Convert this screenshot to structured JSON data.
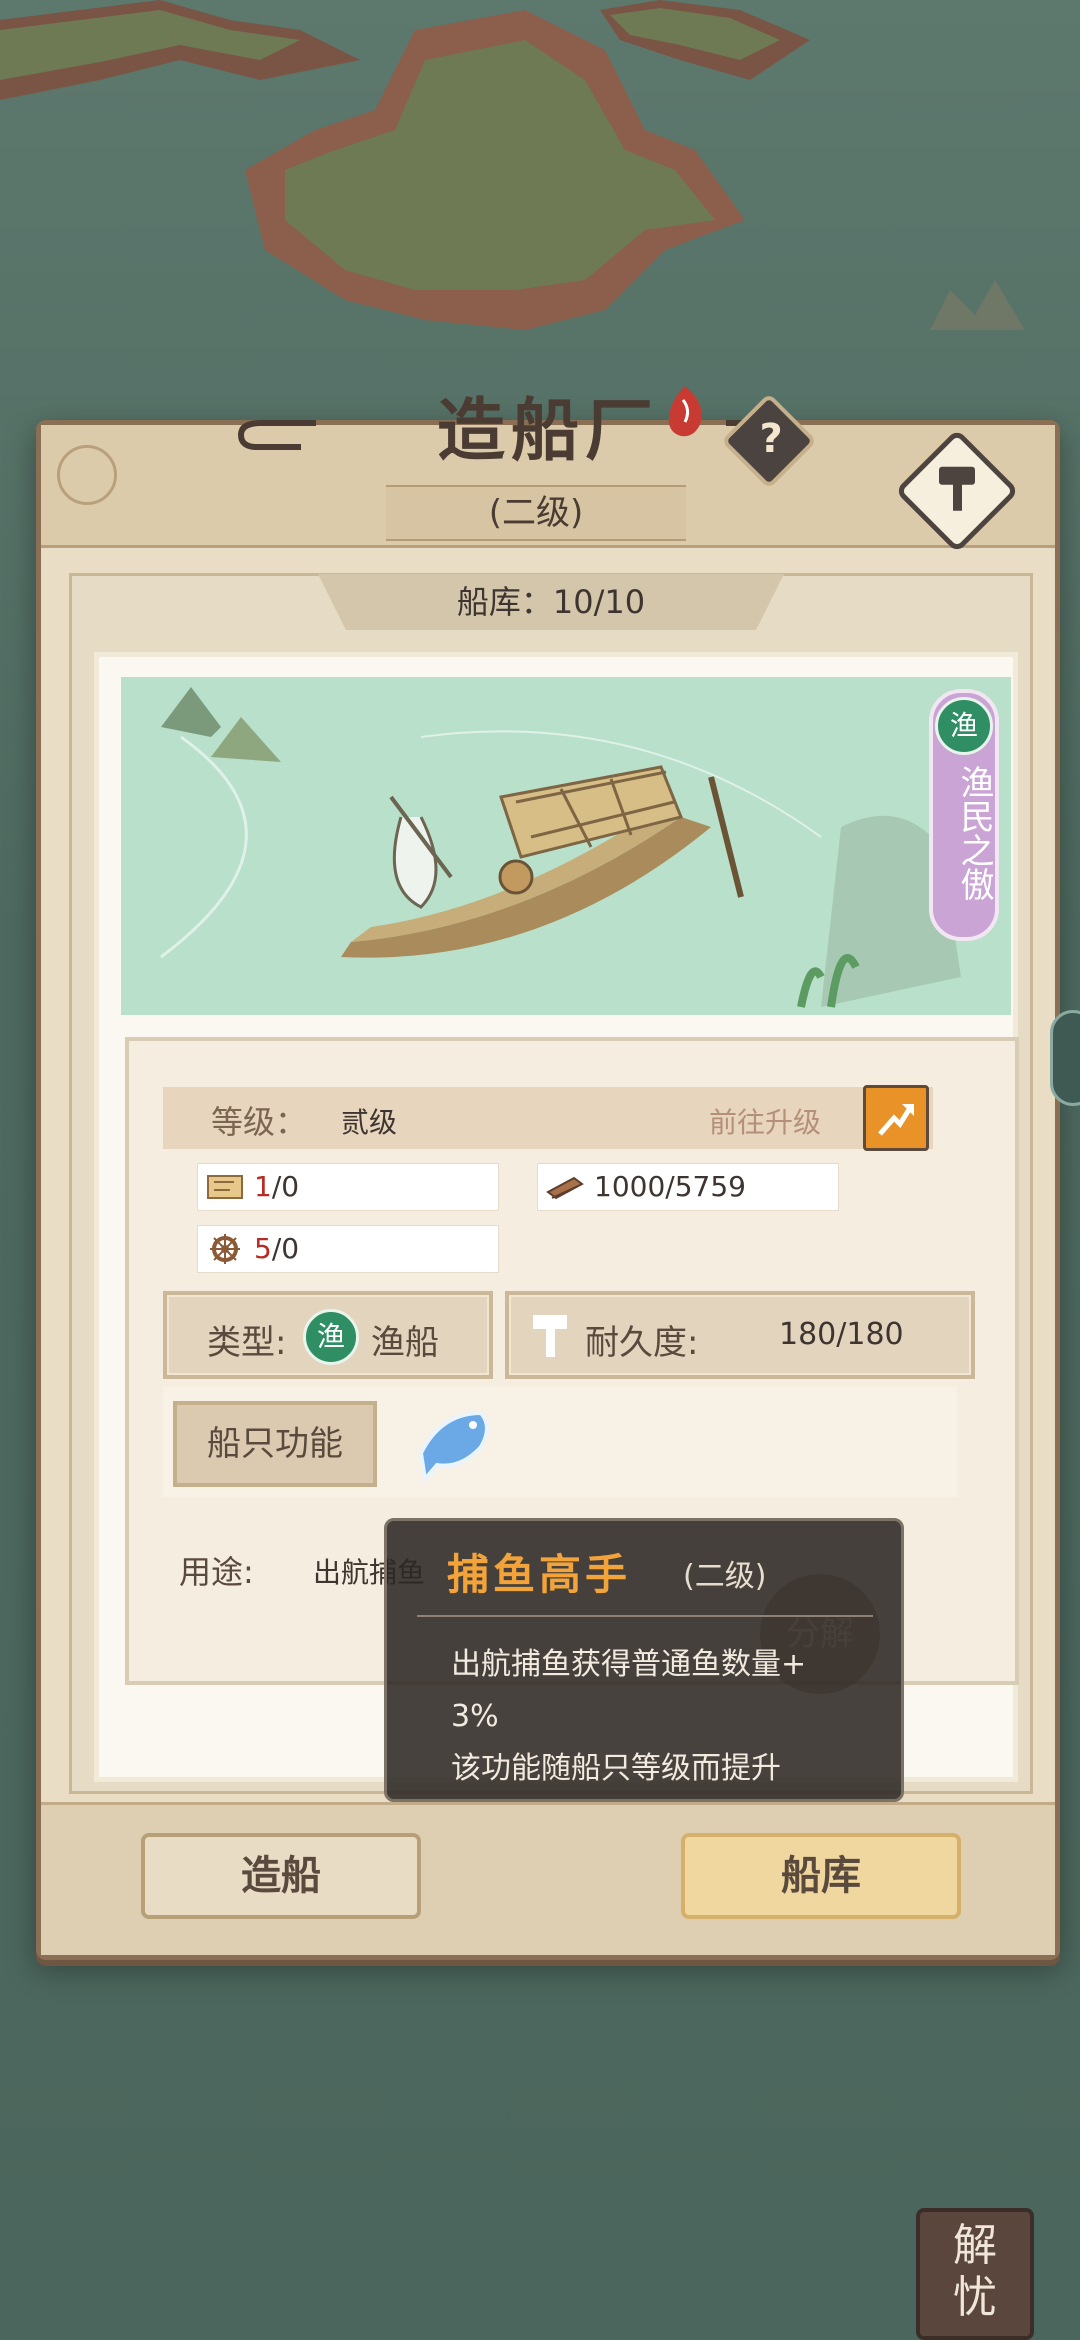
{
  "header": {
    "title": "造船厂",
    "level": "(二级)",
    "help_symbol": "?",
    "storage": "船库：10/10"
  },
  "ship": {
    "faction_icon": "渔",
    "faction_name": "渔民之傲"
  },
  "info": {
    "level_label": "等级：",
    "level_value": "贰级",
    "upgrade_link": "前往升级",
    "resources": [
      {
        "icon": "map-scroll-icon",
        "current": "1",
        "rest": "/0"
      },
      {
        "icon": "wood-plank-icon",
        "current": "",
        "rest": "1000/5759"
      },
      {
        "icon": "ship-wheel-icon",
        "current": "5",
        "rest": "/0"
      }
    ],
    "type_label": "类型:",
    "type_icon": "渔",
    "type_value": "渔船",
    "durability_label": "耐久度:",
    "durability_value": "180/180",
    "function_button": "船只功能",
    "use_label": "用途:",
    "use_value": "出航捕鱼"
  },
  "tooltip": {
    "title": "捕鱼高手",
    "level": "(二级)",
    "desc_line1": "出航捕鱼获得普通鱼数量+",
    "desc_line2": "3%",
    "desc_line3": "该功能随船只等级而提升",
    "decompose_button": "分解"
  },
  "bottom": {
    "build_button": "造船",
    "dock_button": "船库"
  },
  "corner_seal": "解忧",
  "colors": {
    "accent_orange": "#f2a33a",
    "faction_purple": "#c9a4d4",
    "faction_green": "#2f8e63"
  }
}
